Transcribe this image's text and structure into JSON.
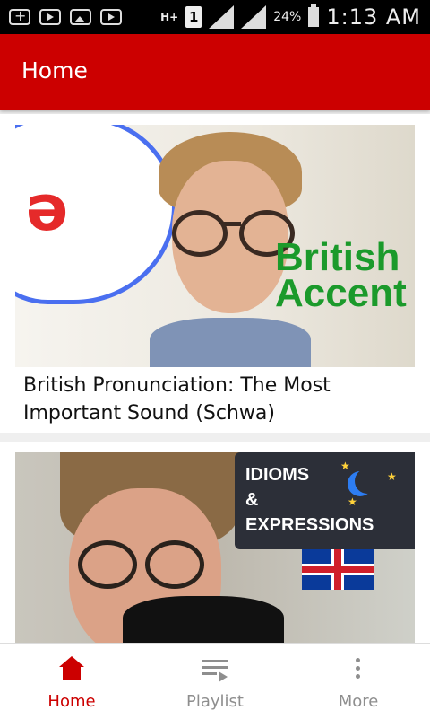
{
  "status_bar": {
    "network": "H+",
    "sim": "1",
    "battery": "24%",
    "time": "1:13 AM"
  },
  "app_bar": {
    "title": "Home"
  },
  "videos": [
    {
      "title": "British Pronunciation: The Most Important Sound (Schwa)",
      "thumb_symbol": "ə",
      "thumb_text": [
        "British",
        "Accent"
      ]
    },
    {
      "title": "",
      "thumb_text": [
        "IDIOMS",
        "&",
        "EXPRESSIONS"
      ]
    }
  ],
  "bottom_nav": [
    {
      "label": "Home",
      "active": true
    },
    {
      "label": "Playlist",
      "active": false
    },
    {
      "label": "More",
      "active": false
    }
  ],
  "colors": {
    "primary": "#cc0000",
    "inactive": "#8e8e8e"
  }
}
